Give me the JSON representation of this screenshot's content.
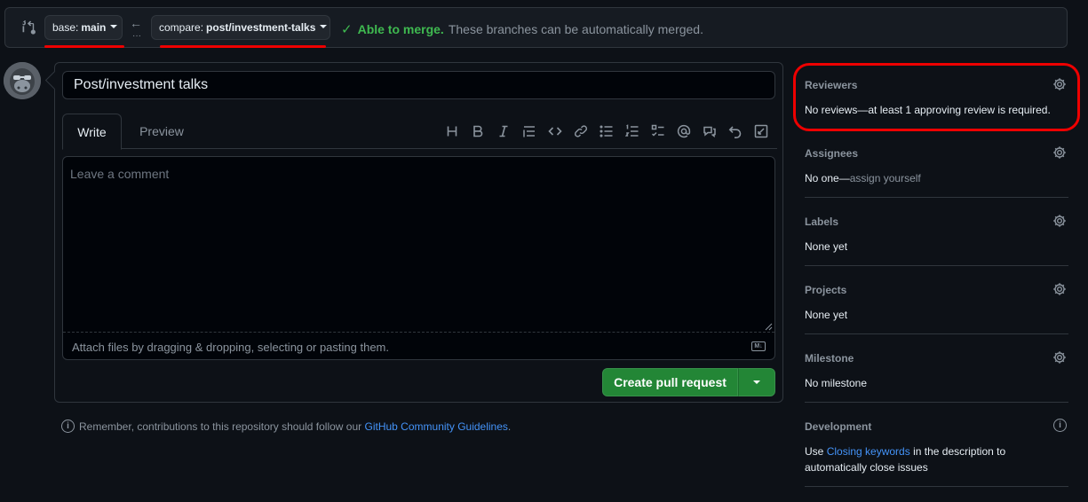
{
  "compare_bar": {
    "base_label": "base:",
    "base_value": "main",
    "compare_label": "compare:",
    "compare_value": "post/investment-talks",
    "merge_ok": "Able to merge.",
    "merge_desc": "These branches can be automatically merged."
  },
  "form": {
    "title_value": "Post/investment talks",
    "tab_write": "Write",
    "tab_preview": "Preview",
    "comment_placeholder": "Leave a comment",
    "attach_hint": "Attach files by dragging & dropping, selecting or pasting them.",
    "markdown_badge": "M↓",
    "create_button": "Create pull request"
  },
  "guidelines": {
    "prefix": "Remember, contributions to this repository should follow our",
    "link": "GitHub Community Guidelines",
    "suffix": "."
  },
  "sidebar": {
    "reviewers": {
      "title": "Reviewers",
      "body": "No reviews—at least 1 approving review is required."
    },
    "assignees": {
      "title": "Assignees",
      "body": "No one—",
      "link": "assign yourself"
    },
    "labels": {
      "title": "Labels",
      "body": "None yet"
    },
    "projects": {
      "title": "Projects",
      "body": "None yet"
    },
    "milestone": {
      "title": "Milestone",
      "body": "No milestone"
    },
    "development": {
      "title": "Development",
      "body_prefix": "Use",
      "link": "Closing keywords",
      "body_suffix": "in the description to automatically close issues"
    }
  },
  "icons": {
    "toolbar": [
      "heading-icon",
      "bold-icon",
      "italic-icon",
      "quote-icon",
      "code-icon",
      "link-icon",
      "unordered-list-icon",
      "ordered-list-icon",
      "task-list-icon",
      "mention-icon",
      "cross-reference-icon",
      "undo-icon",
      "fullscreen-icon"
    ]
  },
  "colors": {
    "accent_green": "#238636",
    "merge_green": "#3fb950",
    "link_blue": "#4493f8",
    "annotation_red": "#ee0000"
  }
}
